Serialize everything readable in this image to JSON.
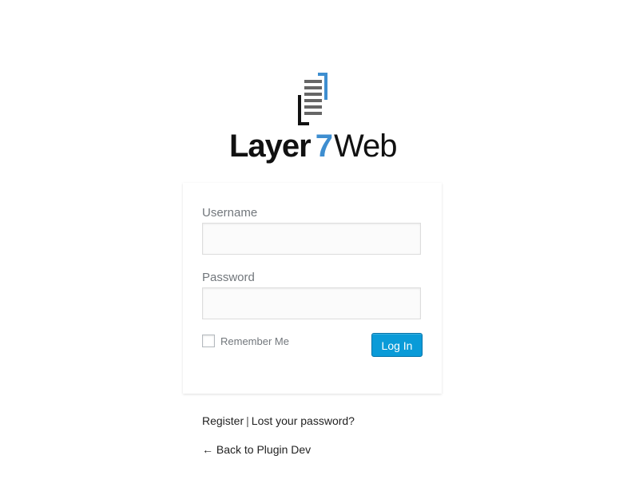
{
  "logo": {
    "word": "Layer",
    "number": "7",
    "suffix": "Web",
    "accent_color": "#3e8ed0",
    "icon": "document-stack-icon"
  },
  "form": {
    "username_label": "Username",
    "username_value": "",
    "password_label": "Password",
    "password_value": "",
    "remember_label": "Remember Me",
    "remember_checked": false,
    "submit_label": "Log In",
    "button_color": "#0a9bd8"
  },
  "links": {
    "register": "Register",
    "separator": "|",
    "lost_password": "Lost your password?",
    "back": "← Back to Plugin Dev"
  }
}
